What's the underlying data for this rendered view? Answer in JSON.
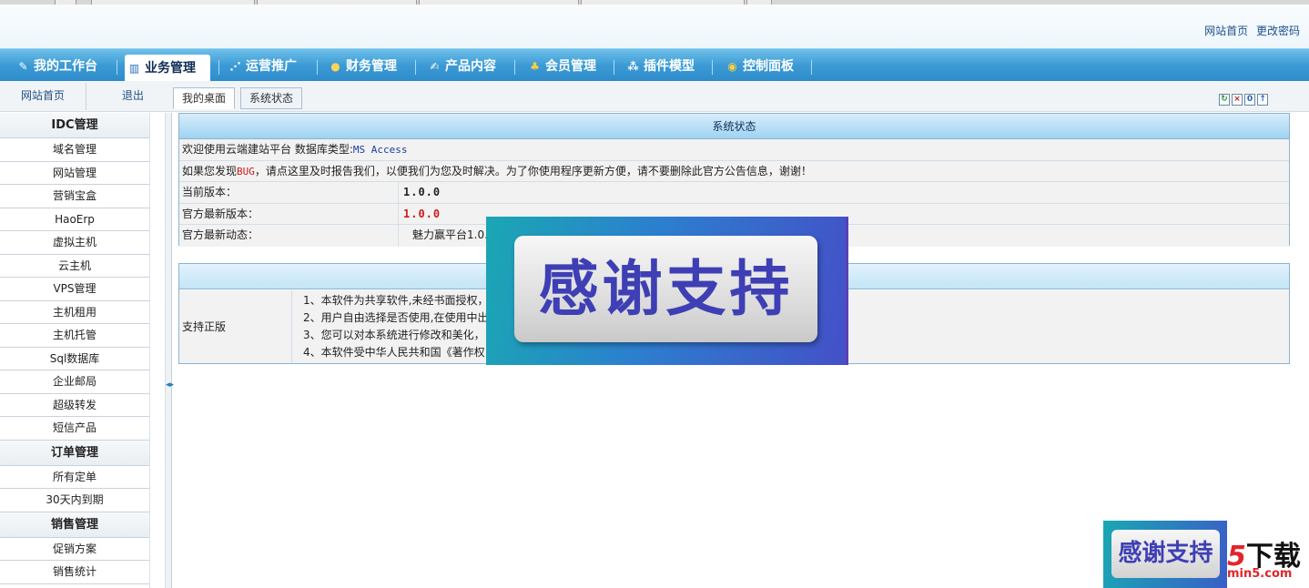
{
  "top_links": {
    "home": "网站首页",
    "change_password": "更改密码"
  },
  "main_nav": [
    {
      "label": "我的工作台",
      "icon": "workbench-icon"
    },
    {
      "label": "业务管理",
      "icon": "chart-icon",
      "active": true
    },
    {
      "label": "运营推广",
      "icon": "network-icon"
    },
    {
      "label": "财务管理",
      "icon": "coins-icon"
    },
    {
      "label": "产品内容",
      "icon": "edit-icon"
    },
    {
      "label": "会员管理",
      "icon": "members-icon"
    },
    {
      "label": "插件模型",
      "icon": "plugin-icon"
    },
    {
      "label": "控制面板",
      "icon": "control-panel-icon"
    }
  ],
  "quick_links": {
    "site_home": "网站首页",
    "logout": "退出"
  },
  "sub_tabs": {
    "desktop": "我的桌面",
    "system_status": "系统状态"
  },
  "toolbar_icons": [
    "refresh-icon",
    "close-icon",
    "info-icon",
    "up-icon"
  ],
  "sidebar": {
    "groups": [
      {
        "title": "IDC管理",
        "items": [
          "域名管理",
          "网站管理",
          "营销宝盒",
          "HaoErp",
          "虚拟主机",
          "云主机",
          "VPS管理",
          "主机租用",
          "主机托管",
          "Sql数据库",
          "企业邮局",
          "超级转发",
          "短信产品"
        ]
      },
      {
        "title": "订单管理",
        "items": [
          "所有定单",
          "30天内到期"
        ]
      },
      {
        "title": "销售管理",
        "items": [
          "促销方案",
          "销售统计"
        ]
      }
    ]
  },
  "status_panel": {
    "title": "系统状态",
    "welcome_prefix": "欢迎使用云端建站平台 数据库类型:",
    "db_type": "MS Access",
    "bug_prefix": "如果您发现",
    "bug_word": "BUG",
    "bug_suffix": "，请点这里及时报告我们，以便我们为您及时解决。为了你使用程序更新方便，请不要删除此官方公告信息，谢谢！",
    "current_version_label": "当前版本：",
    "current_version": "1.0.0",
    "latest_version_label": "官方最新版本：",
    "latest_version": "1.0.0",
    "latest_news_label": "官方最新动态：",
    "latest_news": "魅力赢平台1.0."
  },
  "support_panel": {
    "label": "支持正版",
    "lines": [
      "1、本软件为共享软件,未经书面授权，",
      "2、用户自由选择是否使用,在使用中出",
      "3、您可以对本系统进行修改和美化，",
      "4、本软件受中华人民共和国《著作权"
    ]
  },
  "banner": {
    "text": "感谢支持"
  },
  "watermark": {
    "text": "感谢支持",
    "logo_num": "5",
    "logo_text": "下载",
    "url": "min5.com"
  }
}
